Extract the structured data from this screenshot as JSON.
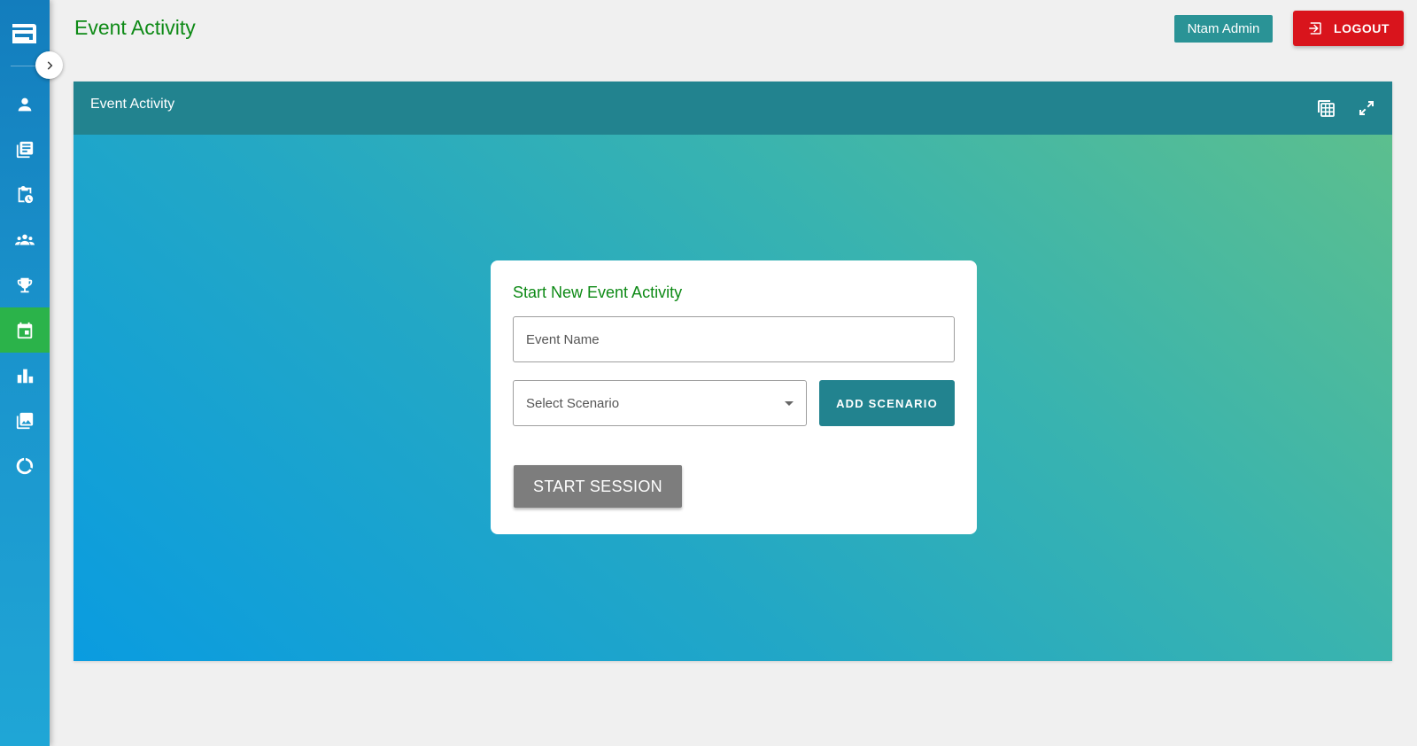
{
  "header": {
    "title": "Event Activity",
    "user_label": "Ntam Admin",
    "logout_label": "LOGOUT"
  },
  "sidebar": {
    "items": [
      {
        "icon": "person-icon",
        "active": false
      },
      {
        "icon": "library-books-icon",
        "active": false
      },
      {
        "icon": "clipboard-clock-icon",
        "active": false
      },
      {
        "icon": "groups-icon",
        "active": false
      },
      {
        "icon": "trophy-icon",
        "active": false
      },
      {
        "icon": "calendar-event-icon",
        "active": true
      },
      {
        "icon": "bar-chart-icon",
        "active": false
      },
      {
        "icon": "photo-library-icon",
        "active": false
      },
      {
        "icon": "donut-loading-icon",
        "active": false
      }
    ]
  },
  "panel": {
    "title": "Event Activity",
    "icons": [
      "table-icon",
      "fullscreen-icon"
    ]
  },
  "form": {
    "title": "Start New Event Activity",
    "event_name_placeholder": "Event Name",
    "event_name_value": "",
    "scenario_placeholder": "Select Scenario",
    "add_scenario_label": "ADD SCENARIO",
    "start_session_label": "START SESSION"
  },
  "colors": {
    "accent_green": "#0e8a16",
    "teal": "#22838f",
    "logout_red": "#d9141c",
    "active_nav": "#2bb34a"
  }
}
